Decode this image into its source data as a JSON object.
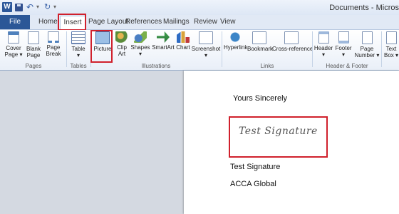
{
  "titlebar": {
    "app_icon": "W",
    "document_title": "Documents - Micros"
  },
  "tabs": [
    "File",
    "Home",
    "Insert",
    "Page Layout",
    "References",
    "Mailings",
    "Review",
    "View"
  ],
  "ribbon": {
    "pages": {
      "label": "Pages",
      "items": [
        {
          "name": "cover-page",
          "line1": "Cover",
          "line2": "Page ▾",
          "icon": "cover-page-icon"
        },
        {
          "name": "blank-page",
          "line1": "Blank",
          "line2": "Page",
          "icon": "blank-page-icon"
        },
        {
          "name": "page-break",
          "line1": "Page",
          "line2": "Break",
          "icon": "page-break-icon"
        }
      ]
    },
    "tables": {
      "label": "Tables",
      "items": [
        {
          "name": "table",
          "line1": "Table",
          "line2": "▾",
          "icon": "table-icon"
        }
      ]
    },
    "illustrations": {
      "label": "Illustrations",
      "items": [
        {
          "name": "picture",
          "line1": "Picture",
          "line2": "",
          "icon": "picture-icon"
        },
        {
          "name": "clip-art",
          "line1": "Clip",
          "line2": "Art",
          "icon": "clip-art-icon"
        },
        {
          "name": "shapes",
          "line1": "Shapes",
          "line2": "▾",
          "icon": "shapes-icon"
        },
        {
          "name": "smartart",
          "line1": "SmartArt",
          "line2": "",
          "icon": "smartart-icon"
        },
        {
          "name": "chart",
          "line1": "Chart",
          "line2": "",
          "icon": "chart-icon"
        },
        {
          "name": "screenshot",
          "line1": "Screenshot",
          "line2": "▾",
          "icon": "screenshot-icon"
        }
      ]
    },
    "links": {
      "label": "Links",
      "items": [
        {
          "name": "hyperlink",
          "line1": "Hyperlink",
          "line2": "",
          "icon": "hyperlink-icon"
        },
        {
          "name": "bookmark",
          "line1": "Bookmark",
          "line2": "",
          "icon": "bookmark-icon"
        },
        {
          "name": "cross-reference",
          "line1": "Cross-reference",
          "line2": "",
          "icon": "cross-reference-icon"
        }
      ]
    },
    "header_footer": {
      "label": "Header & Footer",
      "items": [
        {
          "name": "header",
          "line1": "Header",
          "line2": "▾",
          "icon": "header-icon"
        },
        {
          "name": "footer",
          "line1": "Footer",
          "line2": "▾",
          "icon": "footer-icon"
        },
        {
          "name": "page-number",
          "line1": "Page",
          "line2": "Number ▾",
          "icon": "page-number-icon"
        }
      ]
    },
    "text": {
      "items": [
        {
          "name": "text-box",
          "line1": "Text",
          "line2": "Box ▾",
          "icon": "text-box-icon"
        }
      ]
    }
  },
  "document": {
    "closing": "Yours Sincerely",
    "signature_image_text": "Test Signature",
    "signer_name": "Test Signature",
    "organization": "ACCA Global"
  },
  "colors": {
    "highlight": "#d0202c",
    "file_tab": "#2b5797"
  }
}
